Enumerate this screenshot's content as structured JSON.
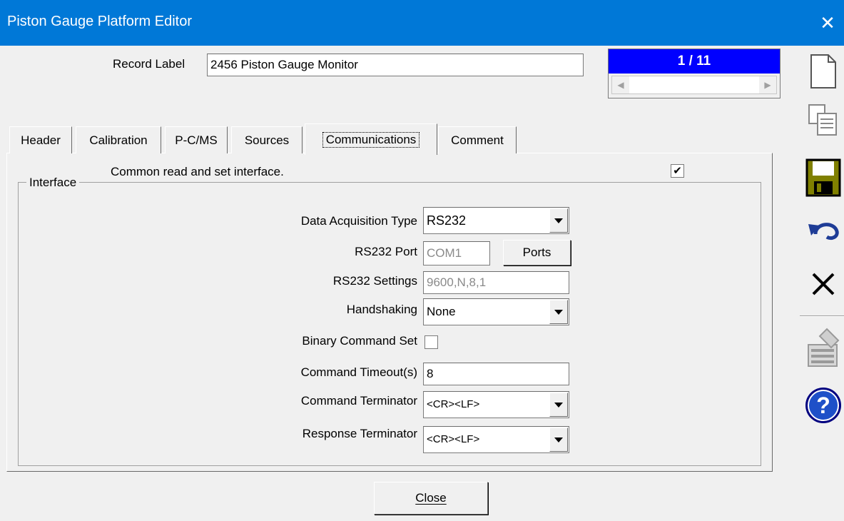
{
  "window": {
    "title": "Piston Gauge Platform Editor"
  },
  "record": {
    "label": "Record Label",
    "value": "2456 Piston Gauge Monitor"
  },
  "navigator": {
    "position": "1 / 11"
  },
  "tabs": [
    {
      "label": "Header"
    },
    {
      "label": "Calibration"
    },
    {
      "label": "P-C/MS"
    },
    {
      "label": "Sources"
    },
    {
      "label": "Communications",
      "active": true
    },
    {
      "label": "Comment"
    }
  ],
  "common_interface": {
    "text": "Common read and set interface.",
    "checked": true
  },
  "interface": {
    "title": "Interface",
    "data_acquisition_type": {
      "label": "Data Acquisition Type",
      "value": "RS232"
    },
    "rs232_port": {
      "label": "RS232 Port",
      "value": "COM1",
      "ports_button": "Ports"
    },
    "rs232_settings": {
      "label": "RS232 Settings",
      "value": "9600,N,8,1"
    },
    "handshaking": {
      "label": "Handshaking",
      "value": "None"
    },
    "binary_command_set": {
      "label": "Binary Command Set",
      "checked": false
    },
    "command_timeout": {
      "label": "Command Timeout(s)",
      "value": "8"
    },
    "command_terminator": {
      "label": "Command Terminator",
      "value": "<CR><LF>"
    },
    "response_terminator": {
      "label": "Response Terminator",
      "value": "<CR><LF>"
    }
  },
  "footer": {
    "close_label": "Close"
  },
  "toolbar_icons": [
    "new-record-icon",
    "copy-record-icon",
    "save-icon",
    "undo-icon",
    "delete-icon",
    "edit-disabled-icon",
    "help-icon"
  ]
}
